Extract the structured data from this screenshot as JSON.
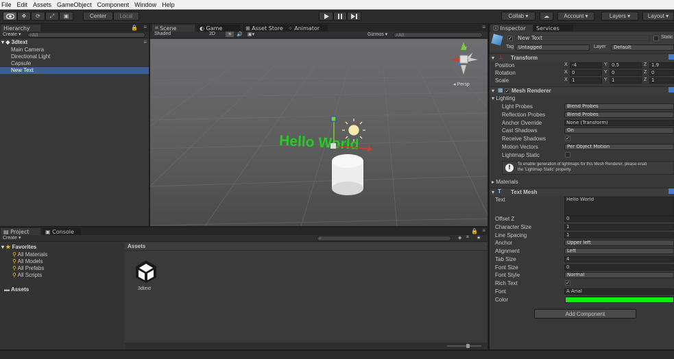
{
  "menu": [
    "File",
    "Edit",
    "Assets",
    "GameObject",
    "Component",
    "Window",
    "Help"
  ],
  "toolbar": {
    "pivot": "Center",
    "space": "Local",
    "collab": "Collab ▾",
    "account": "Account ▾",
    "layers": "Layers ▾",
    "layout": "Layout ▾"
  },
  "hierarchy": {
    "tab": "Hierarchy",
    "create": "Create ▾",
    "search": "All",
    "scene": "3dtext",
    "items": [
      "Main Camera",
      "Directional Light",
      "Capsule",
      "New Text"
    ],
    "selected": "New Text"
  },
  "scene_view": {
    "tabs": [
      "Scene",
      "Game",
      "Asset Store",
      "Animator"
    ],
    "shading": "Shaded",
    "mode2d": "2D",
    "gizmos": "Gizmos ▾",
    "search": "All",
    "persp": "Persp",
    "text_in_scene": "Hello World",
    "text_color": "#22cc22"
  },
  "project": {
    "tabs": [
      "Project",
      "Console"
    ],
    "create": "Create ▾",
    "favorites_label": "Favorites",
    "favorites": [
      "All Materials",
      "All Models",
      "All Prefabs",
      "All Scripts"
    ],
    "assets_root": "Assets",
    "breadcrumb": "Assets",
    "asset_items": [
      "3dtext"
    ]
  },
  "inspector": {
    "tabs": [
      "Inspector",
      "Services"
    ],
    "object_name": "New Text",
    "static_label": "Static",
    "tag_label": "Tag",
    "tag_value": "Untagged",
    "layer_label": "Layer",
    "layer_value": "Default",
    "transform": {
      "title": "Transform",
      "rows": [
        {
          "label": "Position",
          "x": "-4",
          "y": "0.5",
          "z": "1.9"
        },
        {
          "label": "Rotation",
          "x": "0",
          "y": "0",
          "z": "0"
        },
        {
          "label": "Scale",
          "x": "1",
          "y": "1",
          "z": "1"
        }
      ]
    },
    "mesh_renderer": {
      "title": "Mesh Renderer",
      "lighting": "Lighting",
      "light_probes_label": "Light Probes",
      "light_probes": "Blend Probes",
      "reflection_probes_label": "Reflection Probes",
      "reflection_probes": "Blend Probes",
      "anchor_override_label": "Anchor Override",
      "anchor_override": "None (Transform)",
      "cast_shadows_label": "Cast Shadows",
      "cast_shadows": "On",
      "receive_shadows_label": "Receive Shadows",
      "motion_vectors_label": "Motion Vectors",
      "motion_vectors": "Per Object Motion",
      "lightmap_static_label": "Lightmap Static",
      "info_line1": "To enable generation of lightmaps for this Mesh Renderer, please enab",
      "info_line2": "the 'Lightmap Static' property.",
      "materials": "Materials"
    },
    "text_mesh": {
      "title": "Text Mesh",
      "text_label": "Text",
      "text_value": "Hello World",
      "offset_z_label": "Offset Z",
      "offset_z": "0",
      "char_size_label": "Character Size",
      "char_size": "1",
      "line_spacing_label": "Line Spacing",
      "line_spacing": "1",
      "anchor_label": "Anchor",
      "anchor": "Upper left",
      "alignment_label": "Alignment",
      "alignment": "Left",
      "tab_size_label": "Tab Size",
      "tab_size": "4",
      "font_size_label": "Font Size",
      "font_size": "0",
      "font_style_label": "Font Style",
      "font_style": "Normal",
      "rich_text_label": "Rich Text",
      "font_label": "Font",
      "font": "Arial",
      "color_label": "Color",
      "color": "#11ee11"
    },
    "add_component": "Add Component"
  }
}
